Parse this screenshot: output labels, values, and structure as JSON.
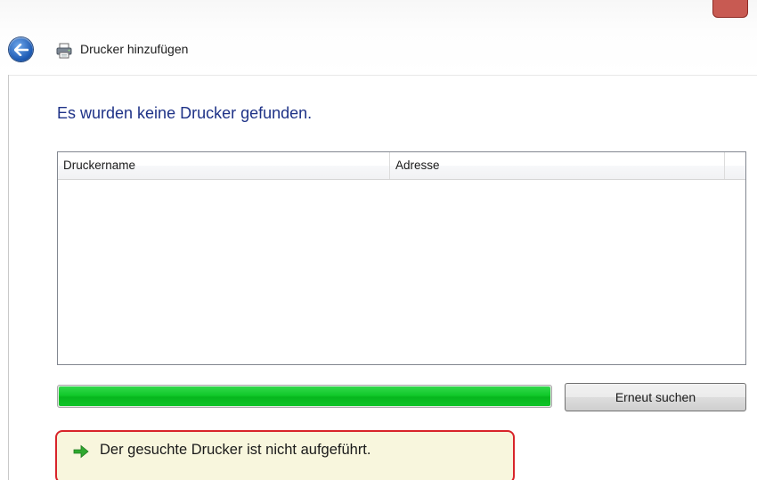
{
  "window": {
    "title": "Drucker hinzufügen",
    "back_icon": "back-arrow-icon",
    "printer_icon": "printer-icon",
    "close_color": "#c85a52"
  },
  "main": {
    "heading": "Es wurden keine Drucker gefunden.",
    "heading_color": "#1e3287"
  },
  "printer_list": {
    "columns": [
      "Druckername",
      "Adresse",
      ""
    ],
    "rows": []
  },
  "search": {
    "progress": 1.0,
    "progress_color": "#11c92a",
    "retry_label": "Erneut suchen"
  },
  "footer_link": {
    "icon": "green-arrow-icon",
    "text": "Der gesuchte Drucker ist nicht aufgeführt."
  }
}
